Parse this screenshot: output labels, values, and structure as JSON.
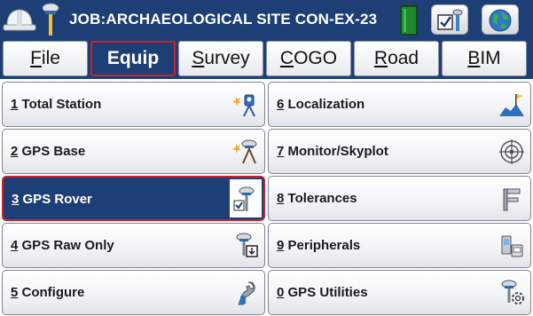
{
  "header": {
    "job_title": "JOB:ARCHAEOLOGICAL SITE CON-EX-23",
    "icons": [
      "hardhat-icon",
      "gps-pole-icon",
      "battery-icon",
      "map-check-icon",
      "globe-icon"
    ],
    "battery_color": "#1e8a2e"
  },
  "tabs": [
    {
      "key": "F",
      "rest": "ile",
      "active": false
    },
    {
      "key": "E",
      "rest": "quip",
      "active": true
    },
    {
      "key": "S",
      "rest": "urvey",
      "active": false
    },
    {
      "key": "C",
      "rest": "OGO",
      "active": false
    },
    {
      "key": "R",
      "rest": "oad",
      "active": false
    },
    {
      "key": "B",
      "rest": "IM",
      "active": false
    }
  ],
  "menu": {
    "left": [
      {
        "num": "1",
        "label": "Total Station",
        "icon": "total-station-icon"
      },
      {
        "num": "2",
        "label": "GPS Base",
        "icon": "gps-base-icon"
      },
      {
        "num": "3",
        "label": "GPS Rover",
        "icon": "gps-rover-icon",
        "active": true
      },
      {
        "num": "4",
        "label": "GPS Raw Only",
        "icon": "gps-raw-icon"
      },
      {
        "num": "5",
        "label": "Configure",
        "icon": "configure-icon"
      }
    ],
    "right": [
      {
        "num": "6",
        "label": "Localization",
        "icon": "localization-icon"
      },
      {
        "num": "7",
        "label": "Monitor/Skyplot",
        "icon": "skyplot-icon"
      },
      {
        "num": "8",
        "label": "Tolerances",
        "icon": "caliper-icon"
      },
      {
        "num": "9",
        "label": "Peripherals",
        "icon": "peripherals-icon"
      },
      {
        "num": "0",
        "label": "GPS Utilities",
        "icon": "gps-utilities-icon"
      }
    ]
  },
  "colors": {
    "navy": "#1e3f75",
    "highlight_border": "#d0202a"
  }
}
